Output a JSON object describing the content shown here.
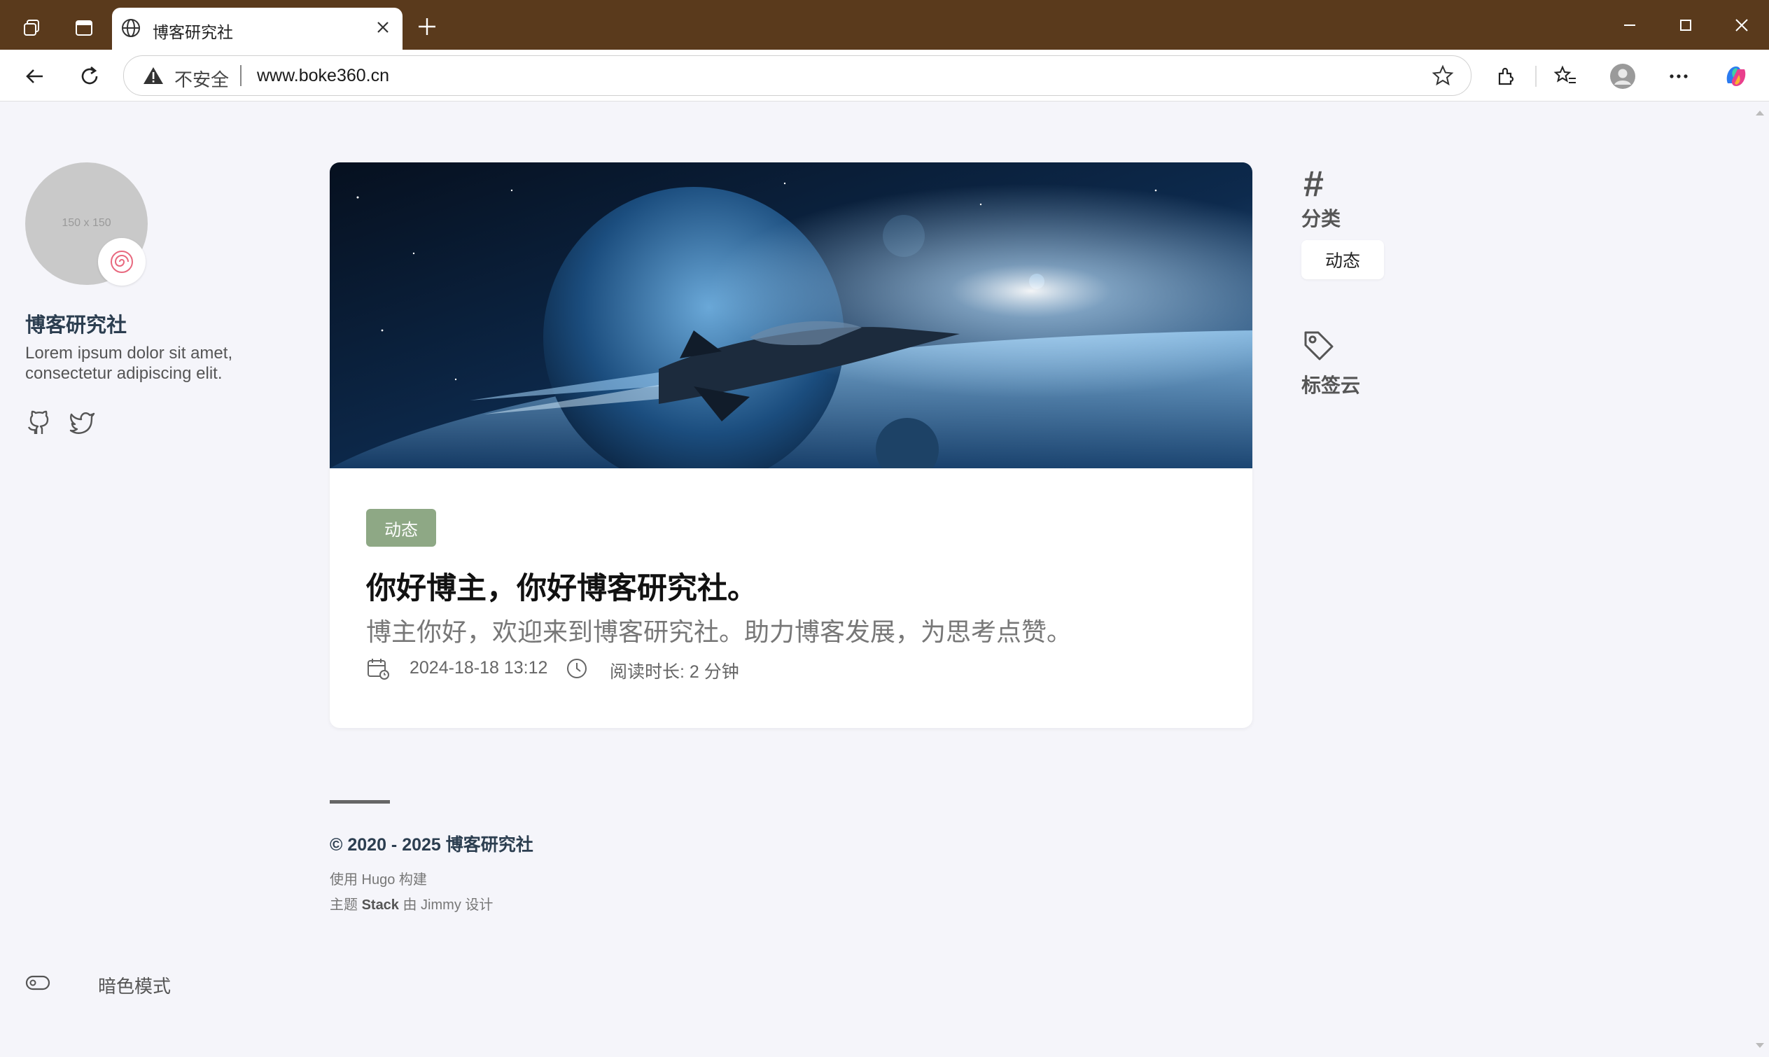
{
  "browser": {
    "tab_title": "博客研究社",
    "security_label": "不安全",
    "url": "www.boke360.cn"
  },
  "sidebar": {
    "avatar_placeholder": "150 x 150",
    "site_title": "博客研究社",
    "site_description": "Lorem ipsum dolor sit amet, consectetur adipiscing elit.",
    "social": [
      "github-icon",
      "twitter-icon"
    ],
    "dark_mode_label": "暗色模式"
  },
  "post": {
    "category": "动态",
    "title": "你好博主，你好博客研究社。",
    "subtitle": "博主你好，欢迎来到博客研究社。助力博客发展，为思考点赞。",
    "date": "2024-18-18 13:12",
    "reading_time": "阅读时长: 2 分钟"
  },
  "footer": {
    "copyright_years": "© 2020 - 2025",
    "copyright_name": "博客研究社",
    "powered_by": "使用 Hugo 构建",
    "theme_prefix": "主题",
    "theme_name": "Stack",
    "theme_suffix": "由 Jimmy 设计"
  },
  "widgets": {
    "categories_title": "分类",
    "categories": [
      "动态"
    ],
    "tags_title": "标签云"
  },
  "colors": {
    "titlebar": "#5a3a1c",
    "page_bg": "#f5f5fa",
    "badge_bg": "#8ea885",
    "site_title": "#2c3e50"
  }
}
